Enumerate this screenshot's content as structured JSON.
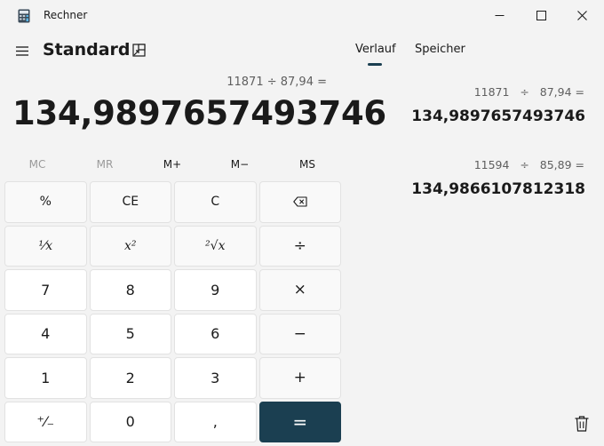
{
  "window": {
    "title": "Rechner"
  },
  "header": {
    "mode": "Standard"
  },
  "display": {
    "expression": "11871 ÷ 87,94 =",
    "value": "134,9897657493746"
  },
  "memory": [
    "MC",
    "MR",
    "M+",
    "M−",
    "MS"
  ],
  "keys": {
    "percent": "%",
    "clear_entry": "CE",
    "clear": "C",
    "reciprocal": "¹⁄x",
    "square": "x²",
    "sqrt": "²√x",
    "divide": "÷",
    "seven": "7",
    "eight": "8",
    "nine": "9",
    "multiply": "×",
    "four": "4",
    "five": "5",
    "six": "6",
    "minus": "−",
    "one": "1",
    "two": "2",
    "three": "3",
    "plus": "+",
    "negate": "⁺⁄₋",
    "zero": "0",
    "decimal": ",",
    "equals": "="
  },
  "tabs": {
    "history": "Verlauf",
    "memory": "Speicher"
  },
  "history": [
    {
      "expression": "11871   ÷   87,94 =",
      "result": "134,9897657493746"
    },
    {
      "expression": "11594   ÷   85,89 =",
      "result": "134,9866107812318"
    }
  ],
  "colors": {
    "accent": "#1b3f51",
    "background": "#f3f3f3"
  }
}
